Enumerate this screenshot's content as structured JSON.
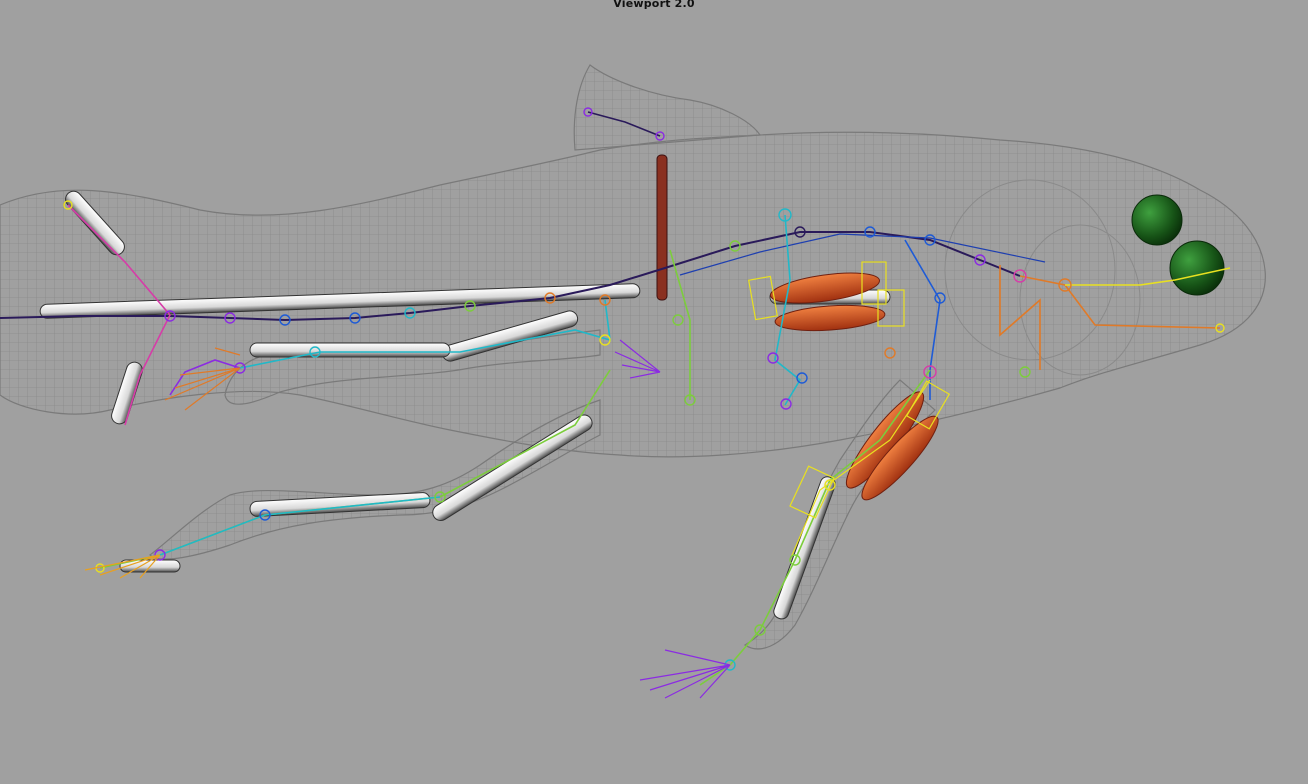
{
  "viewport": {
    "title": "Viewport 2.0",
    "background": "#a0a0a0"
  },
  "scene": {
    "wireframe_color": "#808080",
    "bone_colors": {
      "spine_dark": "#2a1a5a",
      "purple": "#8b2be2",
      "magenta": "#d63ca8",
      "blue": "#1e5bd6",
      "cyan": "#21b8c8",
      "green": "#7ccd3c",
      "yellow": "#e8e020",
      "orange": "#e07a28"
    },
    "muscle_color": "#d8501a",
    "eye_color": "#1f6a1f",
    "bone_geometry_color": "#e6e6e6",
    "icons": [
      "joint-icon",
      "ik-handle-icon",
      "eye-sphere-icon"
    ]
  }
}
